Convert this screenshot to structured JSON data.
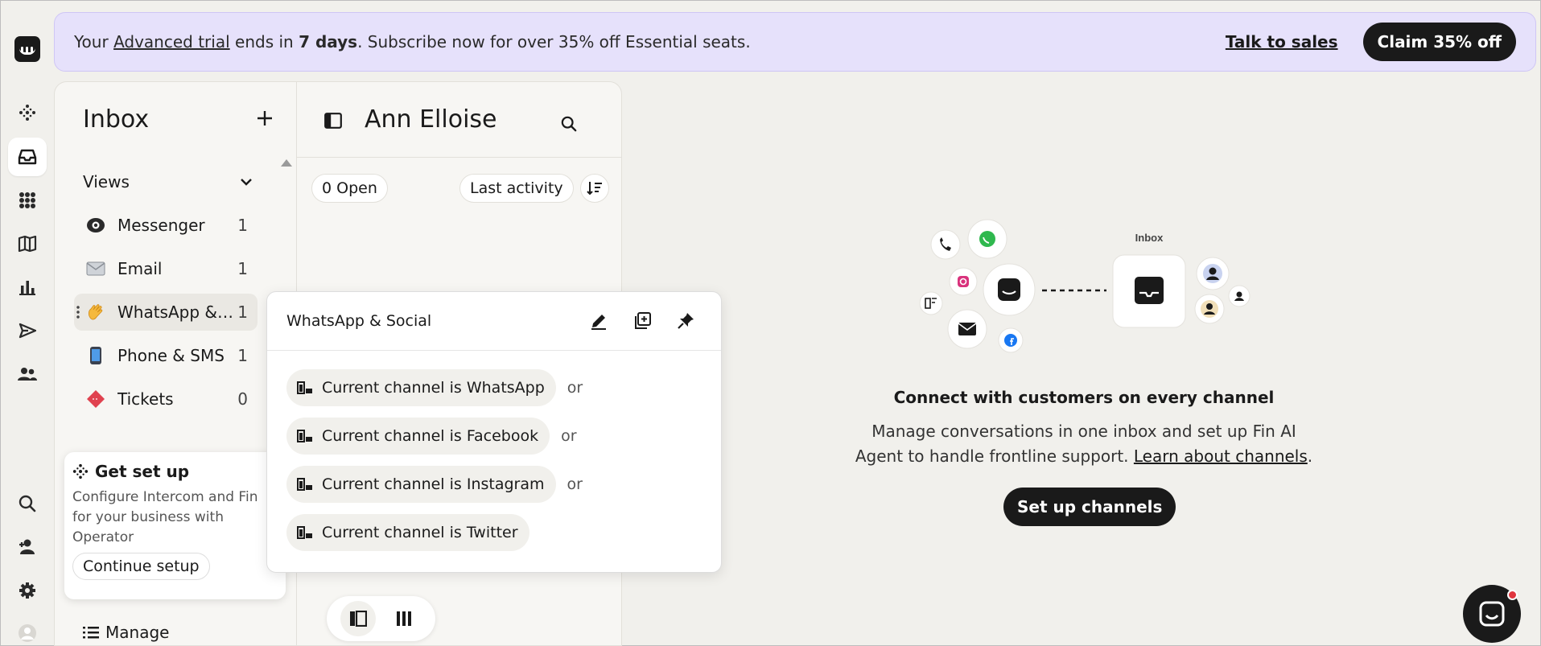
{
  "banner": {
    "prefix": "Your ",
    "trial_link": "Advanced trial",
    "mid": " ends in ",
    "days": "7 days",
    "suffix": ". Subscribe now for over 35% off Essential seats.",
    "talk_to_sales": "Talk to sales",
    "claim": "Claim 35% off"
  },
  "rail": {
    "items": [
      "fin-icon",
      "inbox-icon",
      "apps-icon",
      "knowledge-icon",
      "reports-icon",
      "outbound-icon",
      "contacts-icon",
      "search-icon",
      "add-teammate-icon",
      "settings-icon",
      "profile-icon"
    ],
    "active": "inbox-icon"
  },
  "inbox": {
    "title": "Inbox",
    "views_label": "Views",
    "views": [
      {
        "label": "Messenger",
        "count": "1",
        "icon": "messenger-icon"
      },
      {
        "label": "Email",
        "count": "1",
        "icon": "email-icon"
      },
      {
        "label": "WhatsApp & S...",
        "count": "1",
        "icon": "wave-icon"
      },
      {
        "label": "Phone & SMS",
        "count": "1",
        "icon": "phone-icon"
      },
      {
        "label": "Tickets",
        "count": "0",
        "icon": "ticket-icon"
      }
    ],
    "selected_view": "WhatsApp & S...",
    "setup_card": {
      "title": "Get set up",
      "description": "Configure Intercom and Fin for your business with Operator",
      "button": "Continue setup"
    },
    "manage": "Manage"
  },
  "conversations": {
    "title": "Ann Elloise",
    "open_filter": "0 Open",
    "sort_label": "Last activity"
  },
  "popover": {
    "title": "WhatsApp & Social",
    "rules": [
      {
        "text": "Current channel is WhatsApp",
        "joiner": "or"
      },
      {
        "text": "Current channel is Facebook",
        "joiner": "or"
      },
      {
        "text": "Current channel is Instagram",
        "joiner": "or"
      },
      {
        "text": "Current channel is Twitter",
        "joiner": ""
      }
    ]
  },
  "empty_state": {
    "illustration_label": "Inbox",
    "title": "Connect with customers on every channel",
    "desc_line1": "Manage conversations in one inbox and set up Fin AI",
    "desc_line2_prefix": "Agent to handle frontline support. ",
    "learn_link": "Learn about channels",
    "desc_line2_suffix": ".",
    "button": "Set up channels"
  },
  "colors": {
    "banner_bg": "#e6e1fb",
    "dark": "#1a1a1a",
    "page_bg": "#f1f0ec",
    "notification_dot": "#e0363f"
  }
}
